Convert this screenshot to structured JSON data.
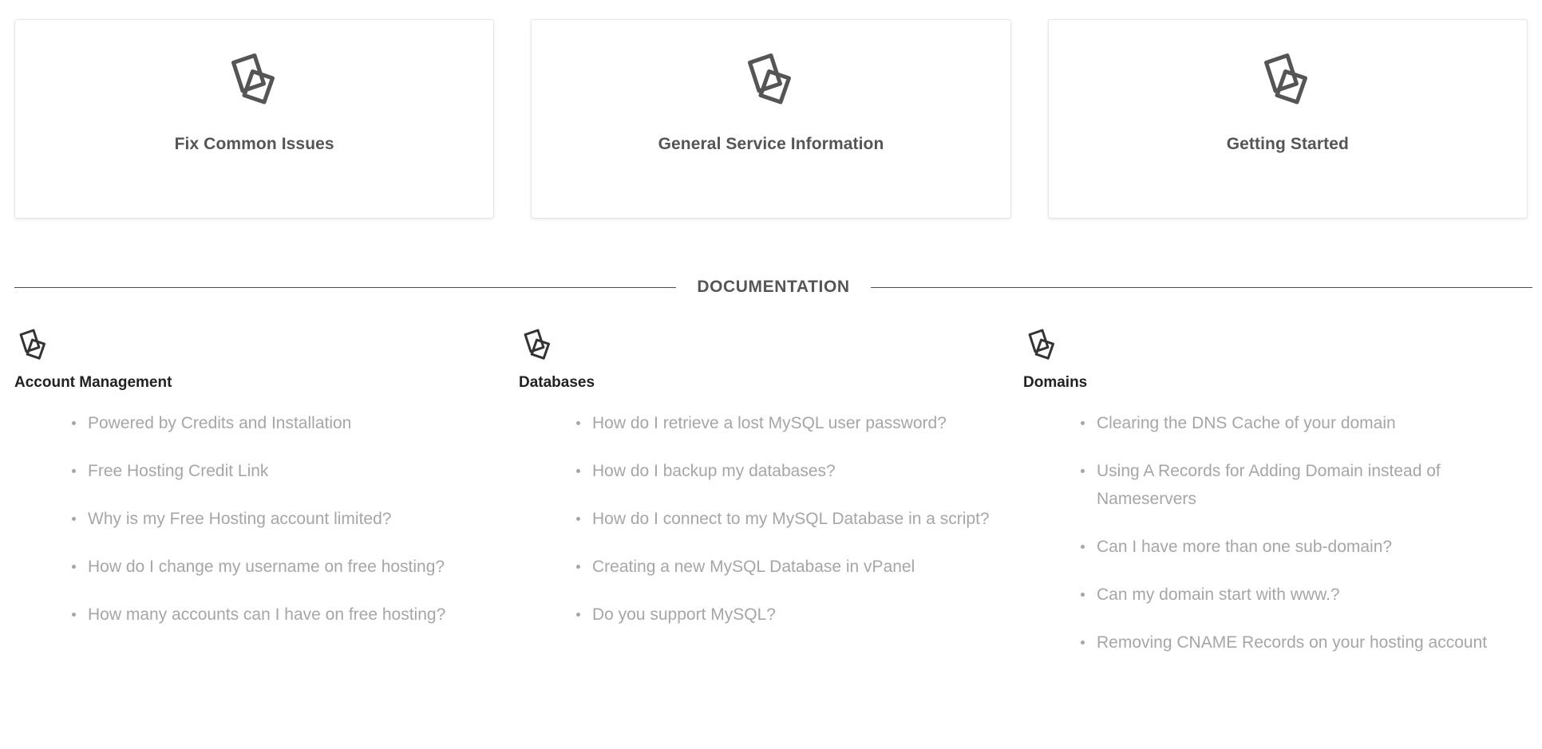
{
  "cards": [
    {
      "title": "Fix Common Issues",
      "icon": "stacked-pages-icon"
    },
    {
      "title": "General Service Information",
      "icon": "stacked-pages-icon"
    },
    {
      "title": "Getting Started",
      "icon": "stacked-pages-icon"
    }
  ],
  "section": {
    "label": "DOCUMENTATION"
  },
  "doc_columns": [
    {
      "heading": "Account Management",
      "icon": "stacked-pages-icon",
      "items": [
        "Powered by Credits and Installation",
        "Free Hosting Credit Link",
        "Why is my Free Hosting account limited?",
        "How do I change my username on free hosting?",
        "How many accounts can I have on free hosting?"
      ]
    },
    {
      "heading": "Databases",
      "icon": "stacked-pages-icon",
      "items": [
        "How do I retrieve a lost MySQL user password?",
        "How do I backup my databases?",
        "How do I connect to my MySQL Database in a script?",
        "Creating a new MySQL Database in vPanel",
        "Do you support MySQL?"
      ]
    },
    {
      "heading": "Domains",
      "icon": "stacked-pages-icon",
      "items": [
        "Clearing the DNS Cache of your domain",
        "Using A Records for Adding Domain instead of Nameservers",
        "Can I have more than one sub-domain?",
        "Can my domain start with www.?",
        "Removing CNAME Records on your hosting account"
      ]
    }
  ],
  "colors": {
    "icon_stroke": "#555555",
    "card_title": "#555555",
    "doc_heading": "#222222",
    "doc_item": "#a6a6a6",
    "divider_line": "#4d4d4d",
    "card_border": "#e7e7e7",
    "background": "#ffffff"
  }
}
